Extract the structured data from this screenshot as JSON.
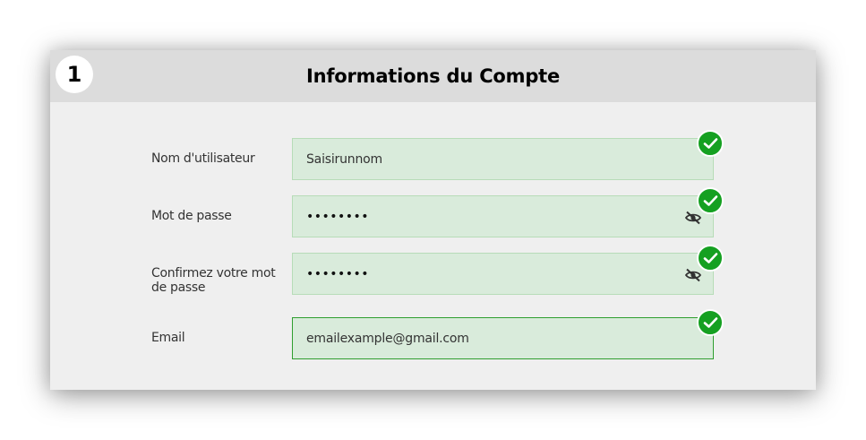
{
  "section": {
    "step_number": "1",
    "title": "Informations du Compte"
  },
  "fields": [
    {
      "label": "Nom d'utilisateur",
      "value": "Saisirunnom",
      "type": "text",
      "valid": true
    },
    {
      "label": "Mot de passe",
      "value": "••••••••",
      "type": "password",
      "valid": true
    },
    {
      "label": "Confirmez votre mot de passe",
      "value": "••••••••",
      "type": "password",
      "valid": true
    },
    {
      "label": "Email",
      "value": "emailexample@gmail.com",
      "type": "email",
      "valid": true
    }
  ],
  "icons": {
    "valid": "check-circle-icon",
    "password_toggle": "eye-slash-icon"
  },
  "colors": {
    "valid_green": "#15a021",
    "field_bg": "#d9ebdb",
    "field_border": "#b7dcb8",
    "active_border": "#2f9e2f",
    "header_bg": "#dcdcdc",
    "card_bg": "#efefef"
  }
}
